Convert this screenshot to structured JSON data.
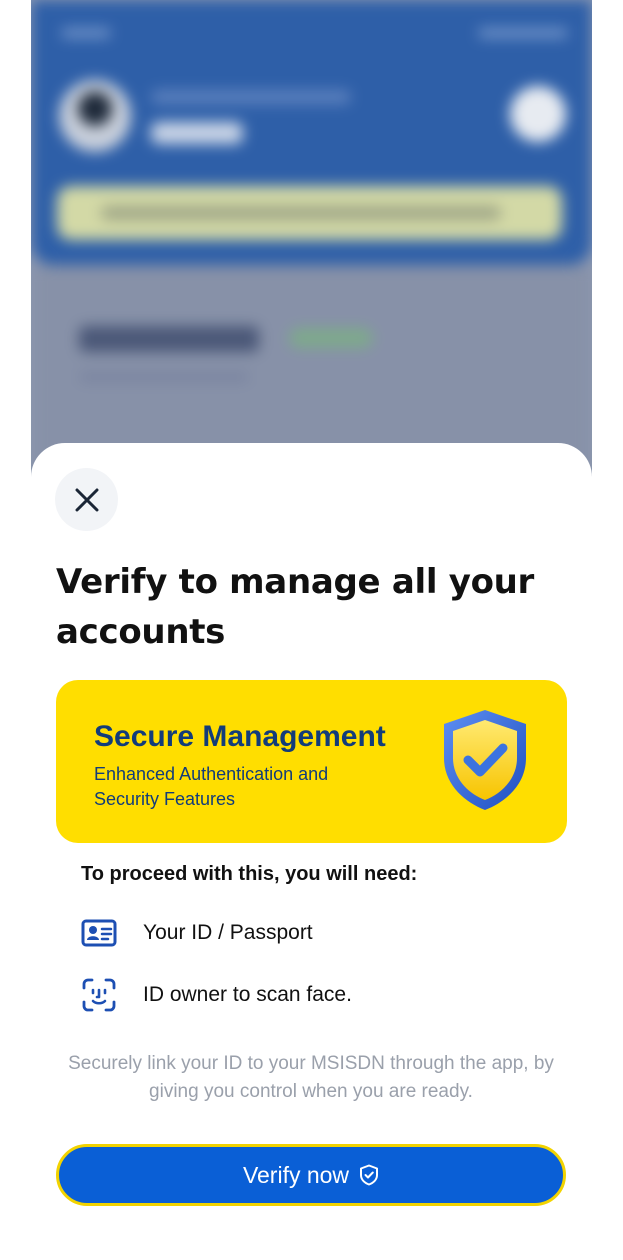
{
  "sheet": {
    "title": "Verify to manage all your accounts",
    "card": {
      "title": "Secure Management",
      "subtitle": "Enhanced Authentication and Security Features",
      "icon": "shield-check-icon"
    },
    "requirements_title": "To proceed with this, you will need:",
    "requirements": [
      {
        "icon": "id-card-icon",
        "label": "Your ID / Passport"
      },
      {
        "icon": "face-scan-icon",
        "label": "ID owner to scan face."
      }
    ],
    "note": "Securely link your ID to your MSISDN through the app, by giving you control when you are ready.",
    "verify_button": {
      "label": "Verify now",
      "icon": "shield-check-outline-icon"
    },
    "close_icon": "close-icon"
  },
  "colors": {
    "accent_yellow": "#ffde00",
    "brand_blue": "#0a5fd6",
    "card_text": "#123c7a",
    "icon_blue": "#1d4fb3"
  }
}
